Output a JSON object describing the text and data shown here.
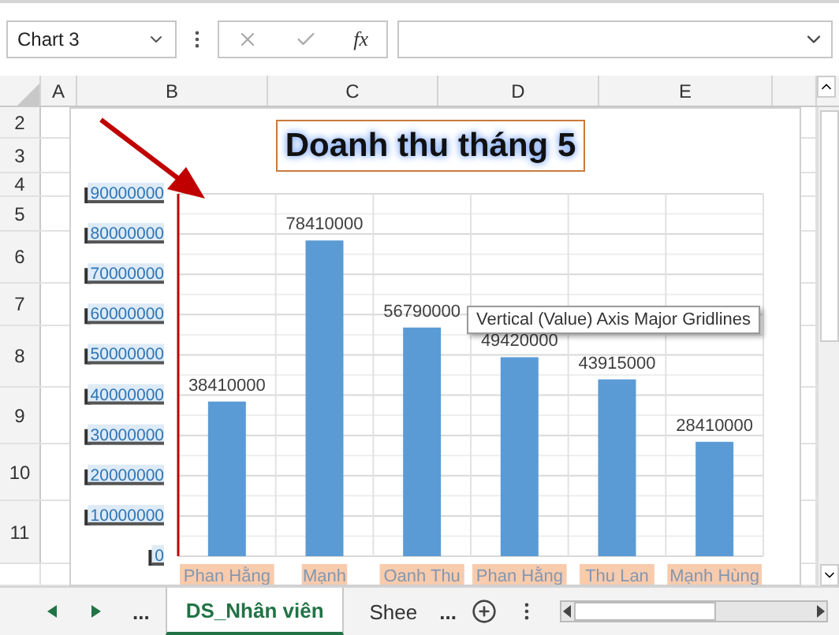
{
  "name_box": {
    "value": "Chart 3"
  },
  "formula_bar": {
    "function_label": "fx"
  },
  "columns": [
    "A",
    "B",
    "C",
    "D",
    "E"
  ],
  "rows": [
    "2",
    "3",
    "4",
    "5",
    "6",
    "7",
    "8",
    "9",
    "10",
    "11"
  ],
  "chart": {
    "title": "Doanh thu tháng 5",
    "chart_data": {
      "type": "bar",
      "categories": [
        "Phan Hằng",
        "Mạnh",
        "Oanh Thu",
        "Phan Hằng",
        "Thu Lan",
        "Mạnh Hùng"
      ],
      "values": [
        38410000,
        78410000,
        56790000,
        49420000,
        43915000,
        28410000
      ],
      "ylim": [
        0,
        90000000
      ],
      "yticks": [
        0,
        10000000,
        20000000,
        30000000,
        40000000,
        50000000,
        60000000,
        70000000,
        80000000,
        90000000
      ],
      "data_labels": true,
      "grid": true
    }
  },
  "tooltip": "Vertical (Value) Axis Major Gridlines",
  "sheet_bar": {
    "more_left": "...",
    "more_right": "...",
    "tabs": [
      {
        "label": "DS_Nhân viên",
        "selected": true
      },
      {
        "label": "Shee",
        "selected": false
      }
    ]
  }
}
